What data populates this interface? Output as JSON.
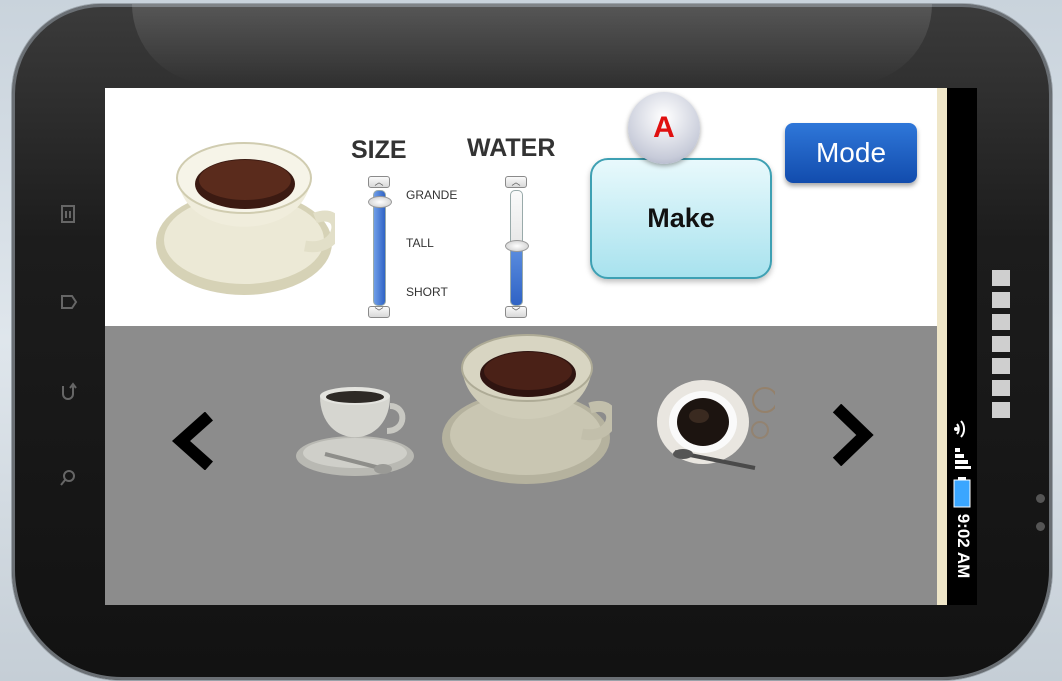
{
  "controls": {
    "size_label": "SIZE",
    "water_label": "WATER",
    "size_ticks": [
      "GRANDE",
      "TALL",
      "SHORT"
    ],
    "size_level": 0.85,
    "water_level": 0.45,
    "make_label": "Make",
    "badge_letter": "A",
    "mode_label": "Mode"
  },
  "carousel": {
    "items": [
      "espresso-cup",
      "coffee-cup-large",
      "coffee-cup-topview"
    ],
    "selected_index": 1
  },
  "status": {
    "time": "9:02 AM",
    "icons": [
      "wifi-icon",
      "signal-icon",
      "battery-icon"
    ]
  },
  "colors": {
    "make_button": "#a8e2ee",
    "mode_button": "#1a5ebf",
    "badge_letter": "#e01010",
    "carousel_bg": "#8c8c8c"
  }
}
